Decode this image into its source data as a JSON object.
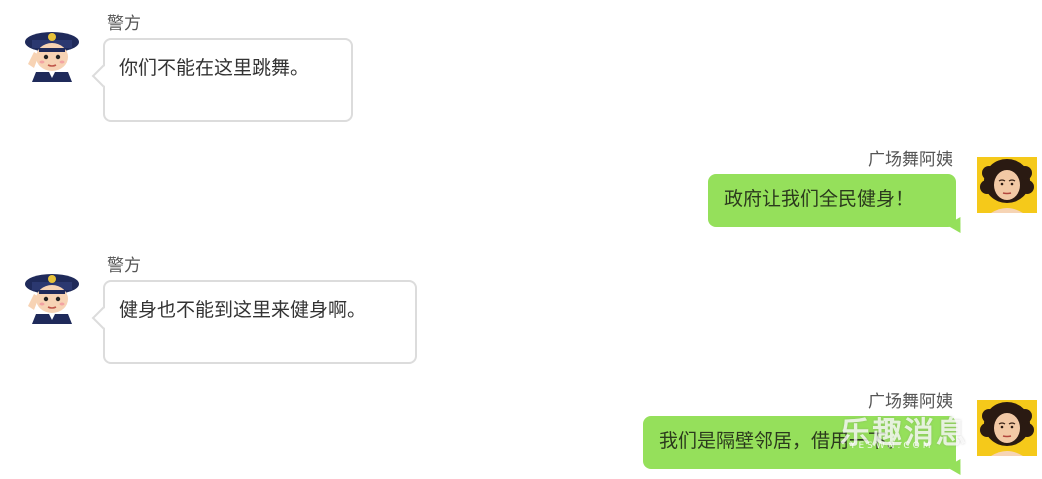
{
  "messages": [
    {
      "side": "left",
      "sender": "警方",
      "text": "你们不能在这里跳舞。",
      "avatar_icon": "police-officer-icon"
    },
    {
      "side": "right",
      "sender": "广场舞阿姨",
      "text": "政府让我们全民健身！",
      "avatar_icon": "auntie-avatar-icon"
    },
    {
      "side": "left",
      "sender": "警方",
      "text": "健身也不能到这里来健身啊。",
      "avatar_icon": "police-officer-icon"
    },
    {
      "side": "right",
      "sender": "广场舞阿姨",
      "text": "我们是隔壁邻居，借用一下。",
      "avatar_icon": "auntie-avatar-icon"
    }
  ],
  "watermark": {
    "text": "乐趣消息",
    "sub": "YESWN.COM"
  },
  "colors": {
    "right_bubble": "#95e05b",
    "left_bubble_border": "#dcdcdc",
    "auntie_avatar_bg": "#f5c91a",
    "police_uniform": "#1f2a5a"
  }
}
